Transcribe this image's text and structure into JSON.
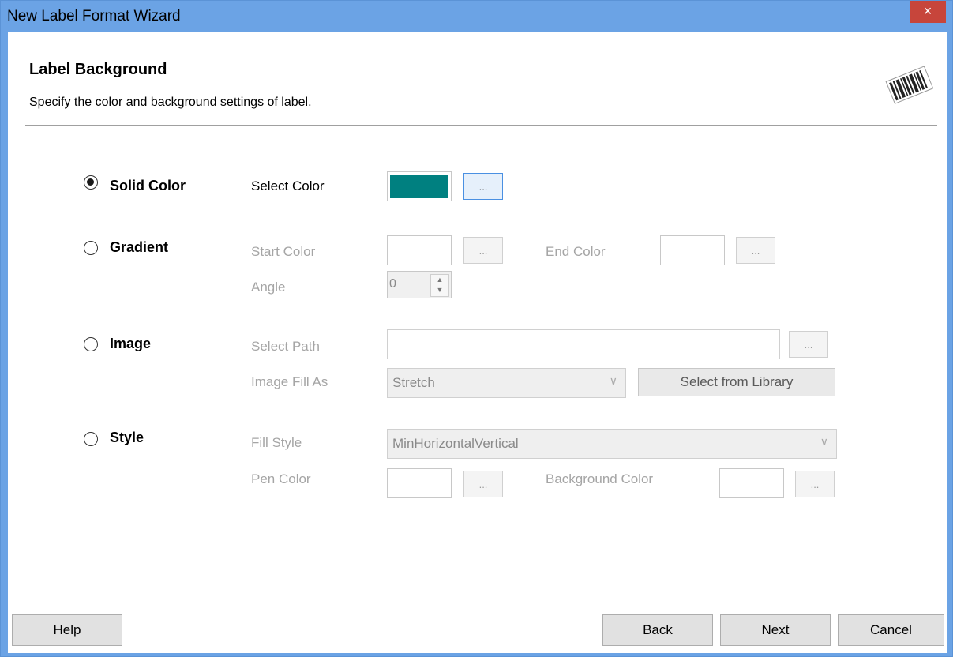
{
  "window": {
    "title": "New Label Format Wizard",
    "close_glyph": "×"
  },
  "header": {
    "title": "Label Background",
    "subtitle": "Specify the color and background settings of label.",
    "icon": "barcode-icon"
  },
  "solid": {
    "label": "Solid Color",
    "checked": true,
    "select_color_label": "Select Color",
    "color": "#008080",
    "browse": "..."
  },
  "gradient": {
    "label": "Gradient",
    "start_color_label": "Start Color",
    "end_color_label": "End Color",
    "angle_label": "Angle",
    "angle_value": "0",
    "browse": "..."
  },
  "image": {
    "label": "Image",
    "select_path_label": "Select Path",
    "path_value": "",
    "fill_as_label": "Image Fill As",
    "fill_as_value": "Stretch",
    "library_button": "Select from Library",
    "browse": "..."
  },
  "style": {
    "label": "Style",
    "fill_style_label": "Fill Style",
    "fill_style_value": "MinHorizontalVertical",
    "pen_color_label": "Pen Color",
    "background_color_label": "Background Color",
    "browse": "..."
  },
  "footer": {
    "help": "Help",
    "back": "Back",
    "next": "Next",
    "cancel": "Cancel"
  },
  "colors": {
    "titlebar": "#6ba3e5",
    "close": "#c7453b",
    "solid_swatch": "#008080"
  }
}
